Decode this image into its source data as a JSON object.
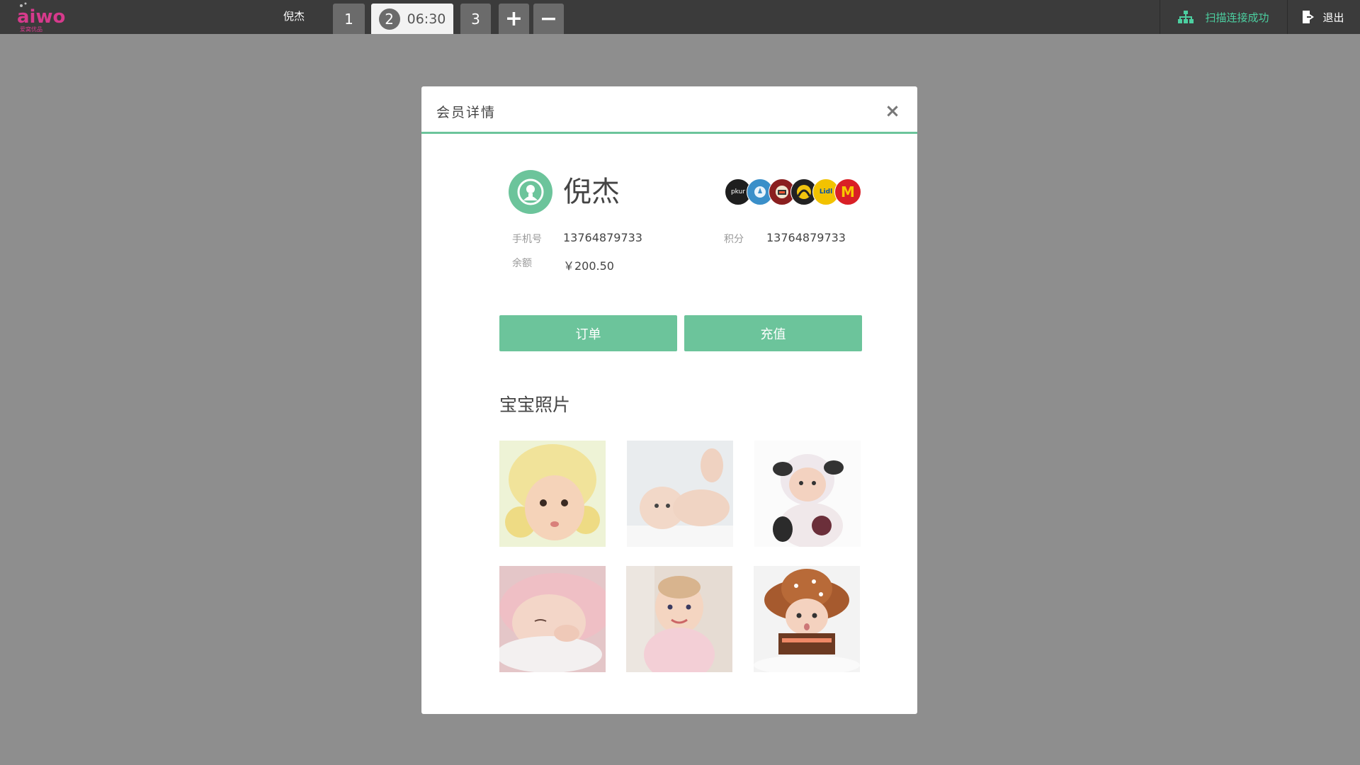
{
  "topbar": {
    "logo_text": "aiwo",
    "logo_sub": "爱窝优品",
    "user_name": "倪杰",
    "tabs": [
      {
        "label": "1"
      },
      {
        "label": "2",
        "time": "06:30"
      },
      {
        "label": "3"
      }
    ],
    "add_label": "+",
    "remove_label": "−",
    "scan_status": "扫描连接成功",
    "logout_label": "退出"
  },
  "modal": {
    "title": "会员详情",
    "close_label": "×",
    "member": {
      "name": "倪杰",
      "phone_label": "手机号",
      "phone": "13764879733",
      "points_label": "积分",
      "points": "13764879733",
      "balance_label": "余额",
      "balance": "￥200.50"
    },
    "badges": [
      {
        "name": "brand-badge-1",
        "color": "#1e1e1e",
        "text": "pkur"
      },
      {
        "name": "brand-badge-2",
        "color": "#3a8fc9",
        "text": ""
      },
      {
        "name": "brand-badge-3",
        "color": "#8a1f1f",
        "text": ""
      },
      {
        "name": "brand-badge-4",
        "color": "#222222",
        "text": ""
      },
      {
        "name": "brand-badge-5",
        "color": "#f2c200",
        "text": "Lidl"
      },
      {
        "name": "brand-badge-6",
        "color": "#d91f26",
        "text": "M"
      }
    ],
    "orders_label": "订单",
    "recharge_label": "充值",
    "photos_title": "宝宝照片"
  },
  "colors": {
    "accent": "#6cc49b",
    "topbar": "#3b3b3b",
    "overlay": "#8e8e8e",
    "scan_text": "#4ccfa0"
  }
}
